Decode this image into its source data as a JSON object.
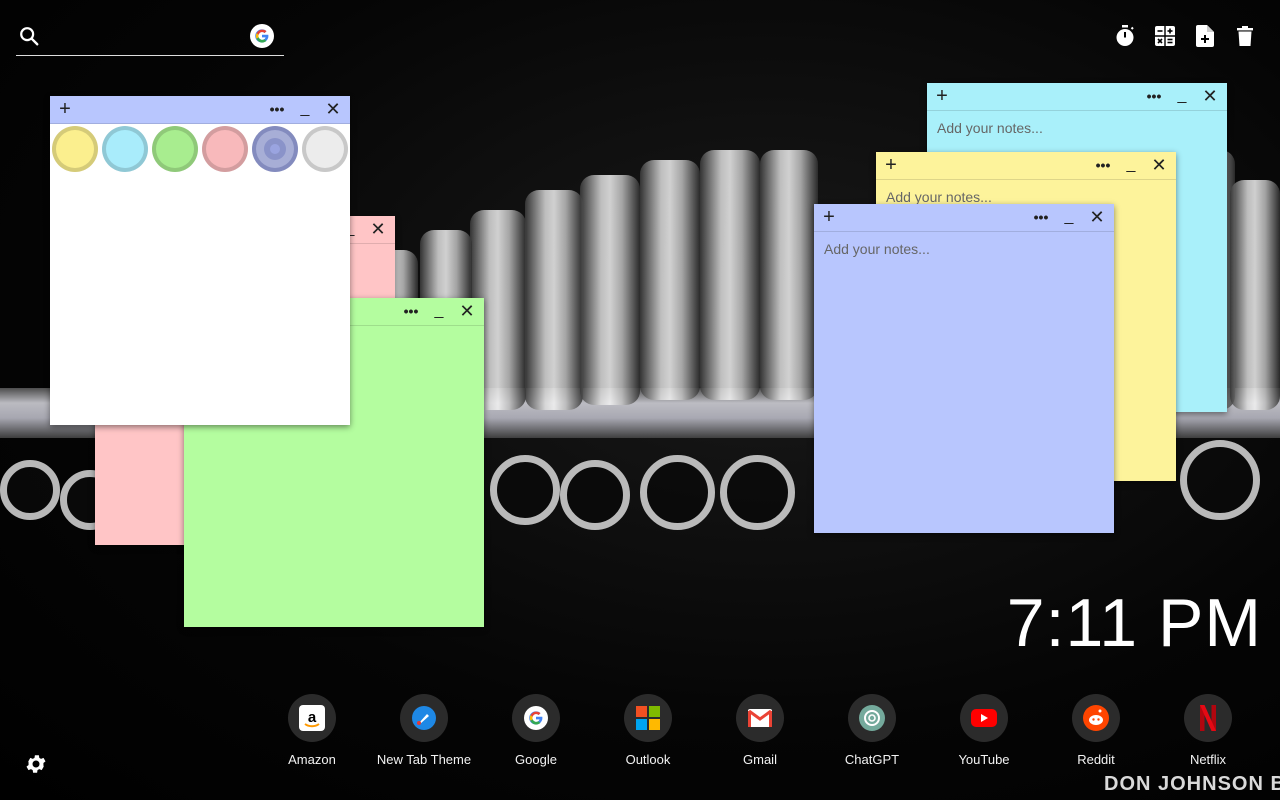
{
  "search": {
    "value": "",
    "placeholder": ""
  },
  "toolbar": {
    "icons": [
      "timer-icon",
      "calculator-icon",
      "new-note-icon",
      "trash-icon"
    ]
  },
  "notes": {
    "white": {
      "color": "#ffffff",
      "swatches": [
        "#fbef8e",
        "#a9ecfb",
        "#a8ed8f",
        "#f8b9bb",
        "#9aa4e0",
        "#ececec"
      ],
      "selected_swatch": 4
    },
    "pink": {
      "color": "#ffc5c6"
    },
    "green": {
      "color": "#b4fd9f"
    },
    "cyan": {
      "color": "#a9f0fa",
      "placeholder": "Add your notes..."
    },
    "yellow": {
      "color": "#fdf39b",
      "placeholder": "Add your notes..."
    },
    "blue": {
      "color": "#b8c6fe",
      "placeholder": "Add your notes..."
    }
  },
  "note_controls": {
    "add": "+",
    "more": "•••",
    "minimize": "_",
    "close": "✕"
  },
  "clock": {
    "time": "7:11 PM"
  },
  "shortcuts": [
    {
      "label": "Amazon",
      "icon": "amazon-icon"
    },
    {
      "label": "New Tab Theme",
      "icon": "new-tab-theme-icon"
    },
    {
      "label": "Google",
      "icon": "google-icon"
    },
    {
      "label": "Outlook",
      "icon": "outlook-icon"
    },
    {
      "label": "Gmail",
      "icon": "gmail-icon"
    },
    {
      "label": "ChatGPT",
      "icon": "chatgpt-icon"
    },
    {
      "label": "YouTube",
      "icon": "youtube-icon"
    },
    {
      "label": "Reddit",
      "icon": "reddit-icon"
    },
    {
      "label": "Netflix",
      "icon": "netflix-icon"
    }
  ],
  "wallpaper": {
    "caption": "DON JOHNSON BIG"
  }
}
